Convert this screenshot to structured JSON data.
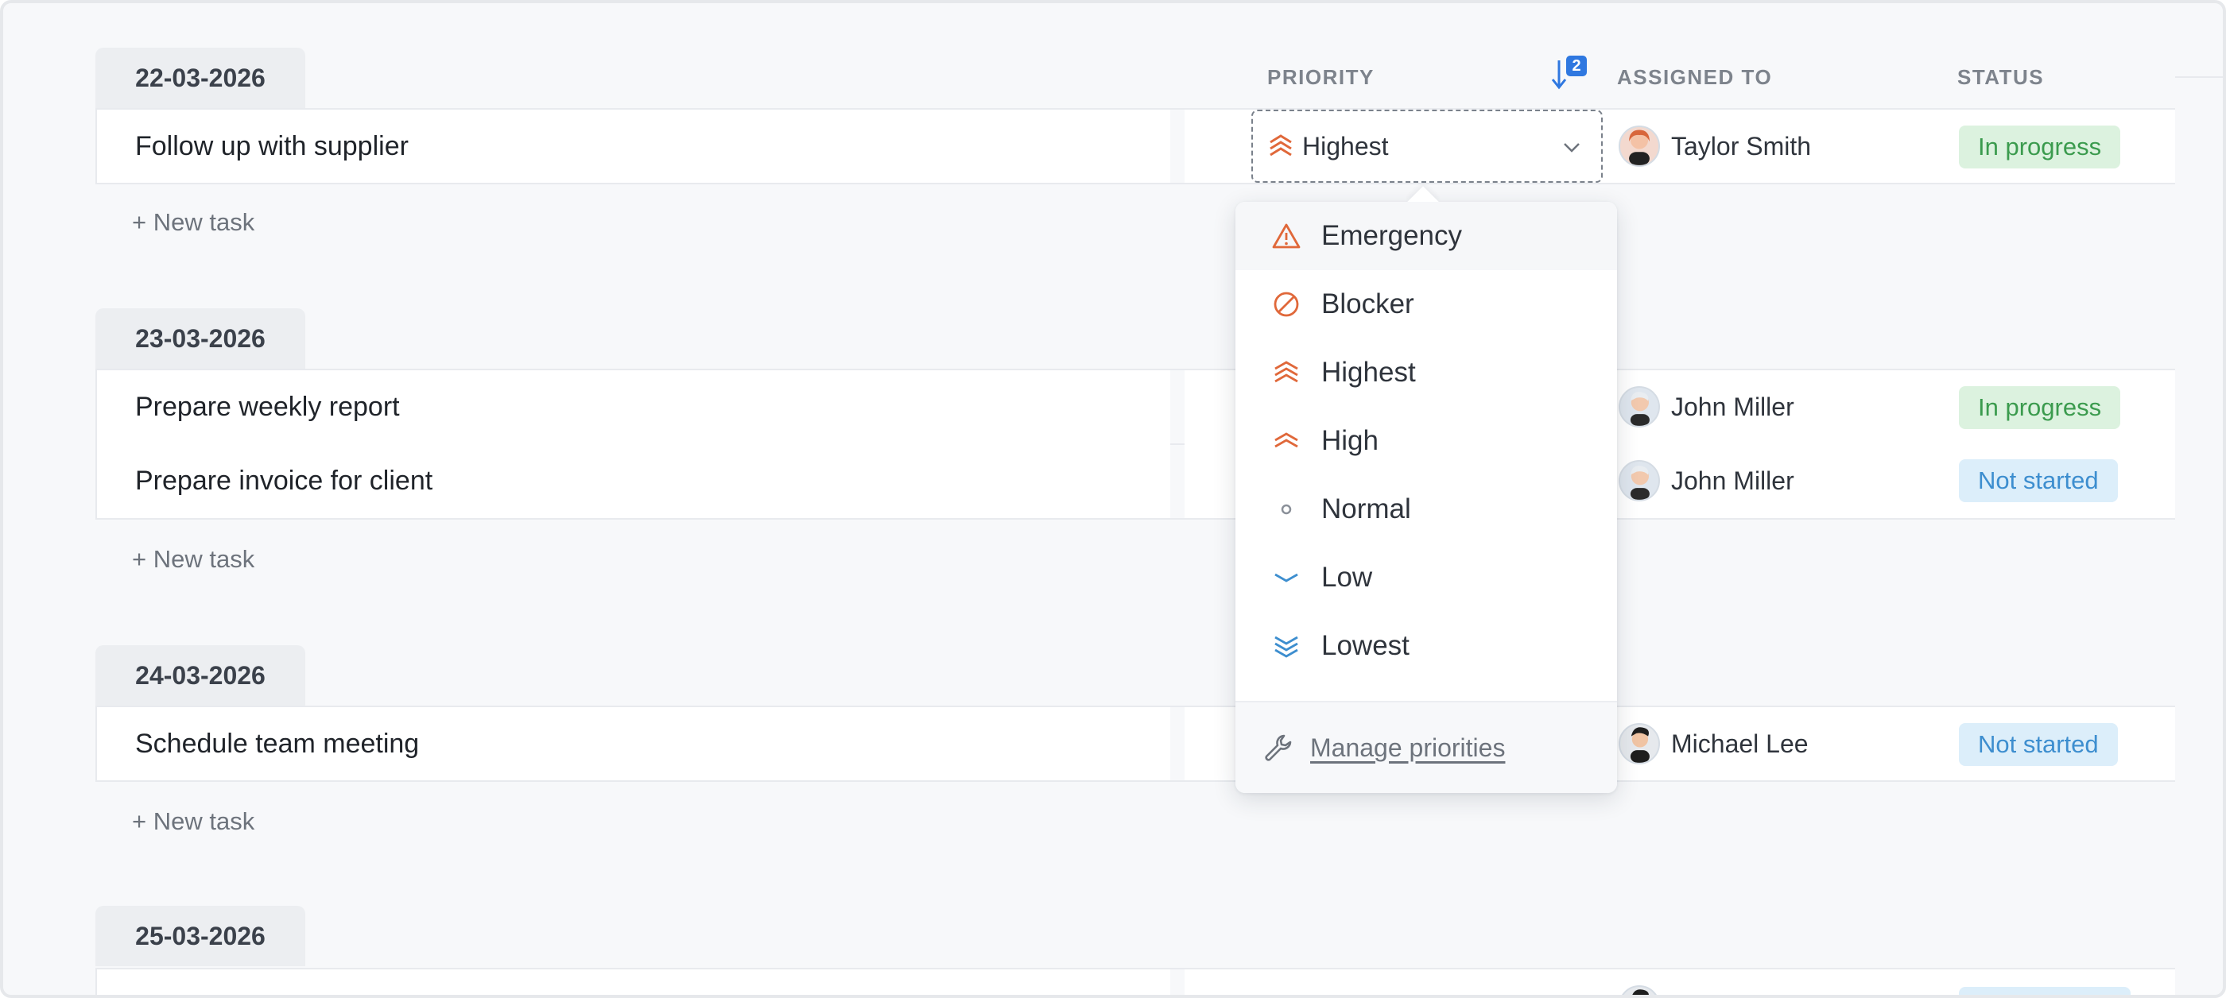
{
  "columns": {
    "priority": "PRIORITY",
    "assigned_to": "ASSIGNED TO",
    "status": "STATUS",
    "sort_badge": "2"
  },
  "groups": [
    {
      "date": "22-03-2026",
      "new_task": "+ New task",
      "tasks": [
        {
          "title": "Follow up with supplier",
          "priority": "Highest",
          "assignee": "Taylor Smith",
          "status": "In progress"
        }
      ]
    },
    {
      "date": "23-03-2026",
      "new_task": "+ New task",
      "tasks": [
        {
          "title": "Prepare weekly report",
          "assignee": "John Miller",
          "status": "In progress"
        },
        {
          "title": "Prepare invoice for client",
          "assignee": "John Miller",
          "status": "Not started"
        }
      ]
    },
    {
      "date": "24-03-2026",
      "new_task": "+ New task",
      "tasks": [
        {
          "title": "Schedule team meeting",
          "assignee": "Michael Lee",
          "status": "Not started"
        }
      ]
    },
    {
      "date": "25-03-2026",
      "tasks": []
    }
  ],
  "priority_dropdown": {
    "items": [
      {
        "label": "Emergency",
        "icon": "warning-icon",
        "color": "#e0683a"
      },
      {
        "label": "Blocker",
        "icon": "blocked-icon",
        "color": "#e0683a"
      },
      {
        "label": "Highest",
        "icon": "triple-chevron-up-icon",
        "color": "#e0683a"
      },
      {
        "label": "High",
        "icon": "double-chevron-up-icon",
        "color": "#e0683a"
      },
      {
        "label": "Normal",
        "icon": "circle-icon",
        "color": "#8a9099"
      },
      {
        "label": "Low",
        "icon": "chevron-down-icon",
        "color": "#3d8ecf"
      },
      {
        "label": "Lowest",
        "icon": "triple-chevron-down-icon",
        "color": "#3d8ecf"
      }
    ],
    "manage_label": "Manage priorities"
  },
  "colors": {
    "accent_blue": "#2f78e0",
    "in_progress_bg": "#dcf2df",
    "in_progress_fg": "#3b9b4e",
    "not_started_bg": "#dceefa",
    "not_started_fg": "#3d8ecf"
  }
}
